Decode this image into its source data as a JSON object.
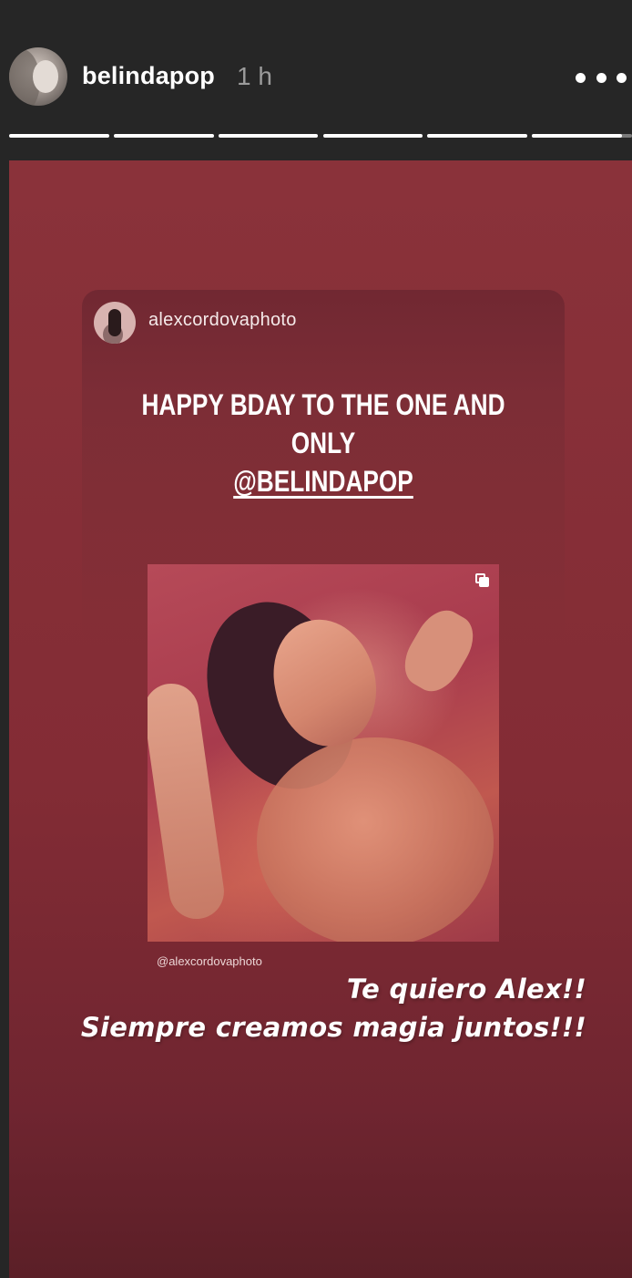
{
  "header": {
    "username": "belindapop",
    "timestamp": "1 h",
    "progress_segments": [
      {
        "state": "viewed",
        "progress": 1.0
      },
      {
        "state": "viewed",
        "progress": 1.0
      },
      {
        "state": "viewed",
        "progress": 1.0
      },
      {
        "state": "viewed",
        "progress": 1.0
      },
      {
        "state": "viewed",
        "progress": 1.0
      },
      {
        "state": "current",
        "progress": 0.9
      }
    ]
  },
  "story": {
    "background_color": "#8a323a",
    "shared_post": {
      "author": "alexcordovaphoto",
      "caption_line1": "HAPPY BDAY TO THE ONE AND ONLY",
      "caption_mention": "@BELINDAPOP",
      "photo_credit": "@alexcordovaphoto",
      "multi_photo_icon": "gallery-icon"
    },
    "sticker_line1": "Te quiero Alex!!",
    "sticker_line2": "Siempre creamos magia juntos!!!"
  }
}
